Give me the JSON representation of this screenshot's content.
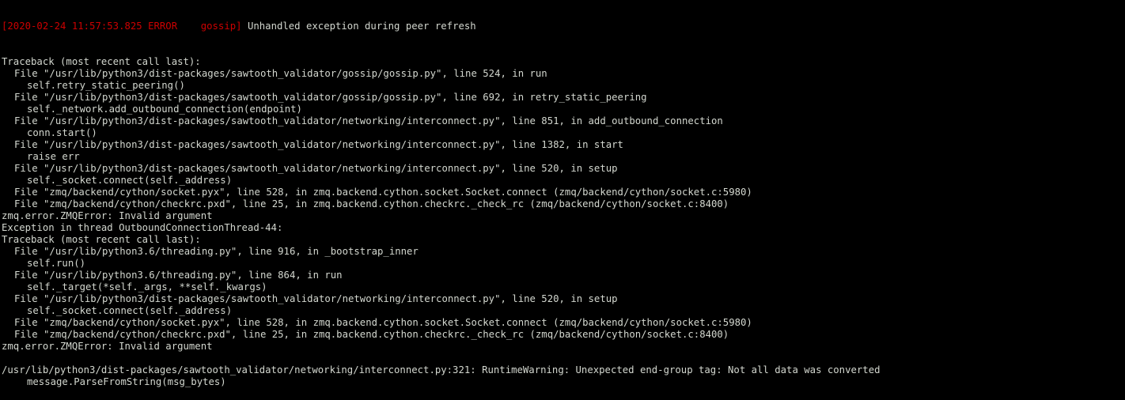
{
  "terminal": {
    "header": {
      "timestamp_level": "[2020-02-24 11:57:53.825 ERROR    gossip]",
      "message": " Unhandled exception during peer refresh"
    },
    "lines": [
      {
        "text": "Traceback (most recent call last):",
        "indent": 0
      },
      {
        "text": "File \"/usr/lib/python3/dist-packages/sawtooth_validator/gossip/gossip.py\", line 524, in run",
        "indent": 1
      },
      {
        "text": "self.retry_static_peering()",
        "indent": 2
      },
      {
        "text": "File \"/usr/lib/python3/dist-packages/sawtooth_validator/gossip/gossip.py\", line 692, in retry_static_peering",
        "indent": 1
      },
      {
        "text": "self._network.add_outbound_connection(endpoint)",
        "indent": 2
      },
      {
        "text": "File \"/usr/lib/python3/dist-packages/sawtooth_validator/networking/interconnect.py\", line 851, in add_outbound_connection",
        "indent": 1
      },
      {
        "text": "conn.start()",
        "indent": 2
      },
      {
        "text": "File \"/usr/lib/python3/dist-packages/sawtooth_validator/networking/interconnect.py\", line 1382, in start",
        "indent": 1
      },
      {
        "text": "raise err",
        "indent": 2
      },
      {
        "text": "File \"/usr/lib/python3/dist-packages/sawtooth_validator/networking/interconnect.py\", line 520, in setup",
        "indent": 1
      },
      {
        "text": "self._socket.connect(self._address)",
        "indent": 2
      },
      {
        "text": "File \"zmq/backend/cython/socket.pyx\", line 528, in zmq.backend.cython.socket.Socket.connect (zmq/backend/cython/socket.c:5980)",
        "indent": 1
      },
      {
        "text": "File \"zmq/backend/cython/checkrc.pxd\", line 25, in zmq.backend.cython.checkrc._check_rc (zmq/backend/cython/socket.c:8400)",
        "indent": 1
      },
      {
        "text": "zmq.error.ZMQError: Invalid argument",
        "indent": 0
      },
      {
        "text": "Exception in thread OutboundConnectionThread-44:",
        "indent": 0
      },
      {
        "text": "Traceback (most recent call last):",
        "indent": 0
      },
      {
        "text": "File \"/usr/lib/python3.6/threading.py\", line 916, in _bootstrap_inner",
        "indent": 1
      },
      {
        "text": "self.run()",
        "indent": 2
      },
      {
        "text": "File \"/usr/lib/python3.6/threading.py\", line 864, in run",
        "indent": 1
      },
      {
        "text": "self._target(*self._args, **self._kwargs)",
        "indent": 2
      },
      {
        "text": "File \"/usr/lib/python3/dist-packages/sawtooth_validator/networking/interconnect.py\", line 520, in setup",
        "indent": 1
      },
      {
        "text": "self._socket.connect(self._address)",
        "indent": 2
      },
      {
        "text": "File \"zmq/backend/cython/socket.pyx\", line 528, in zmq.backend.cython.socket.Socket.connect (zmq/backend/cython/socket.c:5980)",
        "indent": 1
      },
      {
        "text": "File \"zmq/backend/cython/checkrc.pxd\", line 25, in zmq.backend.cython.checkrc._check_rc (zmq/backend/cython/socket.c:8400)",
        "indent": 1
      },
      {
        "text": "zmq.error.ZMQError: Invalid argument",
        "indent": 0
      },
      {
        "text": "",
        "indent": 0
      },
      {
        "text": "/usr/lib/python3/dist-packages/sawtooth_validator/networking/interconnect.py:321: RuntimeWarning: Unexpected end-group tag: Not all data was converted",
        "indent": 0
      },
      {
        "text": "message.ParseFromString(msg_bytes)",
        "indent": 2
      }
    ],
    "colors": {
      "background": "#000000",
      "foreground": "#d3d7cf",
      "error": "#cc0000"
    }
  }
}
